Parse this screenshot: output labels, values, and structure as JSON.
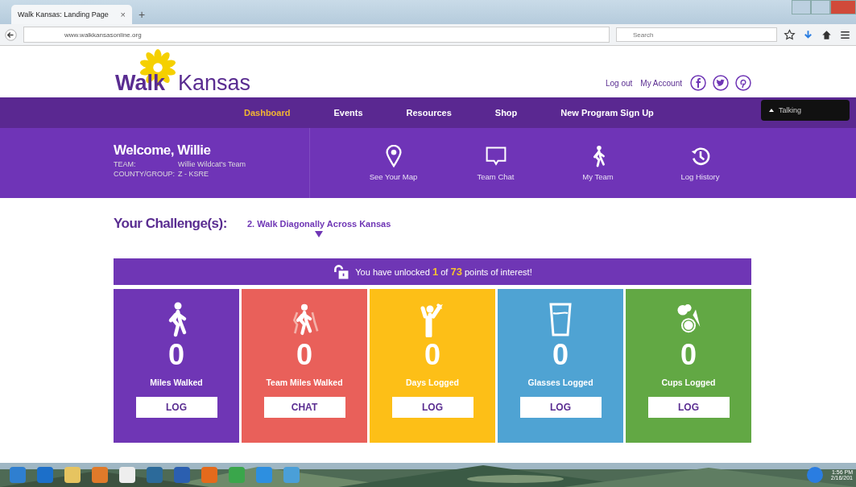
{
  "browser": {
    "tab_title": "Walk Kansas: Landing Page",
    "tab_close": "×",
    "new_tab": "+",
    "url": "www.walkkansasonline.org",
    "search_placeholder": "Search"
  },
  "header": {
    "logo_left": "Walk",
    "logo_right": "Kansas",
    "links": [
      "Log out",
      "My Account"
    ]
  },
  "nav": [
    {
      "label": "Dashboard",
      "selected": true
    },
    {
      "label": "Events",
      "selected": false
    },
    {
      "label": "Resources",
      "selected": false
    },
    {
      "label": "Shop",
      "selected": false
    },
    {
      "label": "New Program Sign Up",
      "selected": false
    }
  ],
  "tooltip": "Talking",
  "welcome": {
    "title": "Welcome, Willie",
    "rows": [
      {
        "label": "TEAM:",
        "value": "Willie Wildcat's Team"
      },
      {
        "label": "COUNTY/GROUP:",
        "value": "Z - KSRE"
      }
    ]
  },
  "quick_links": [
    {
      "kind": "map",
      "label": "See Your Map"
    },
    {
      "kind": "chat",
      "label": "Team Chat"
    },
    {
      "kind": "team",
      "label": "My Team"
    },
    {
      "kind": "history",
      "label": "Log History"
    }
  ],
  "challenge": {
    "label": "Your Challenge(s):",
    "value": "2. Walk Diagonally Across Kansas"
  },
  "banner": "You have unlocked **1** of **73** points of interest!",
  "stats": [
    {
      "kind": "walker",
      "value": "0",
      "label": "Miles Walked",
      "button": "LOG",
      "color": "#6f36b5"
    },
    {
      "kind": "team",
      "value": "0",
      "label": "Team Miles Walked",
      "button": "CHAT",
      "color": "#e9605a"
    },
    {
      "kind": "cheer",
      "value": "0",
      "label": "Days Logged",
      "button": "LOG",
      "color": "#fdbf17"
    },
    {
      "kind": "glass",
      "value": "0",
      "label": "Glasses Logged",
      "button": "LOG",
      "color": "#4fa3d3"
    },
    {
      "kind": "veggies",
      "value": "0",
      "label": "Cups Logged",
      "button": "LOG",
      "color": "#62a844"
    }
  ],
  "taskbar": {
    "time": "1:56 PM",
    "date": "2/16/201"
  }
}
